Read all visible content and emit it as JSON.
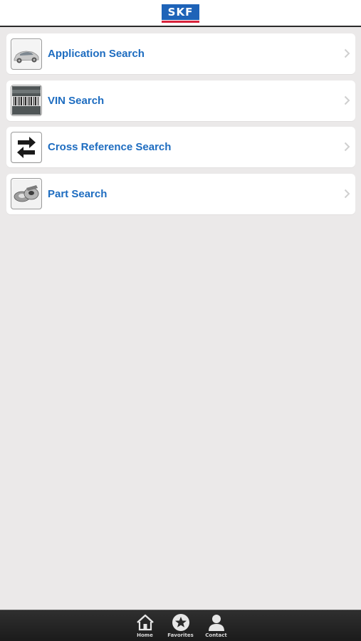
{
  "header": {
    "logo_text": "SKF",
    "brand_colors": {
      "logo_blue": "#1e63b8",
      "logo_red": "#d8223a"
    }
  },
  "menu": {
    "items": [
      {
        "label": "Application Search",
        "icon": "car-icon"
      },
      {
        "label": "VIN Search",
        "icon": "barcode-icon"
      },
      {
        "label": "Cross Reference Search",
        "icon": "swap-arrows-icon"
      },
      {
        "label": "Part Search",
        "icon": "bearing-part-icon"
      }
    ],
    "label_color": "#1d6cc0"
  },
  "tabbar": {
    "tabs": [
      {
        "label": "Home",
        "icon": "home-icon"
      },
      {
        "label": "Favorites",
        "icon": "star-icon"
      },
      {
        "label": "Contact",
        "icon": "person-icon"
      }
    ]
  }
}
